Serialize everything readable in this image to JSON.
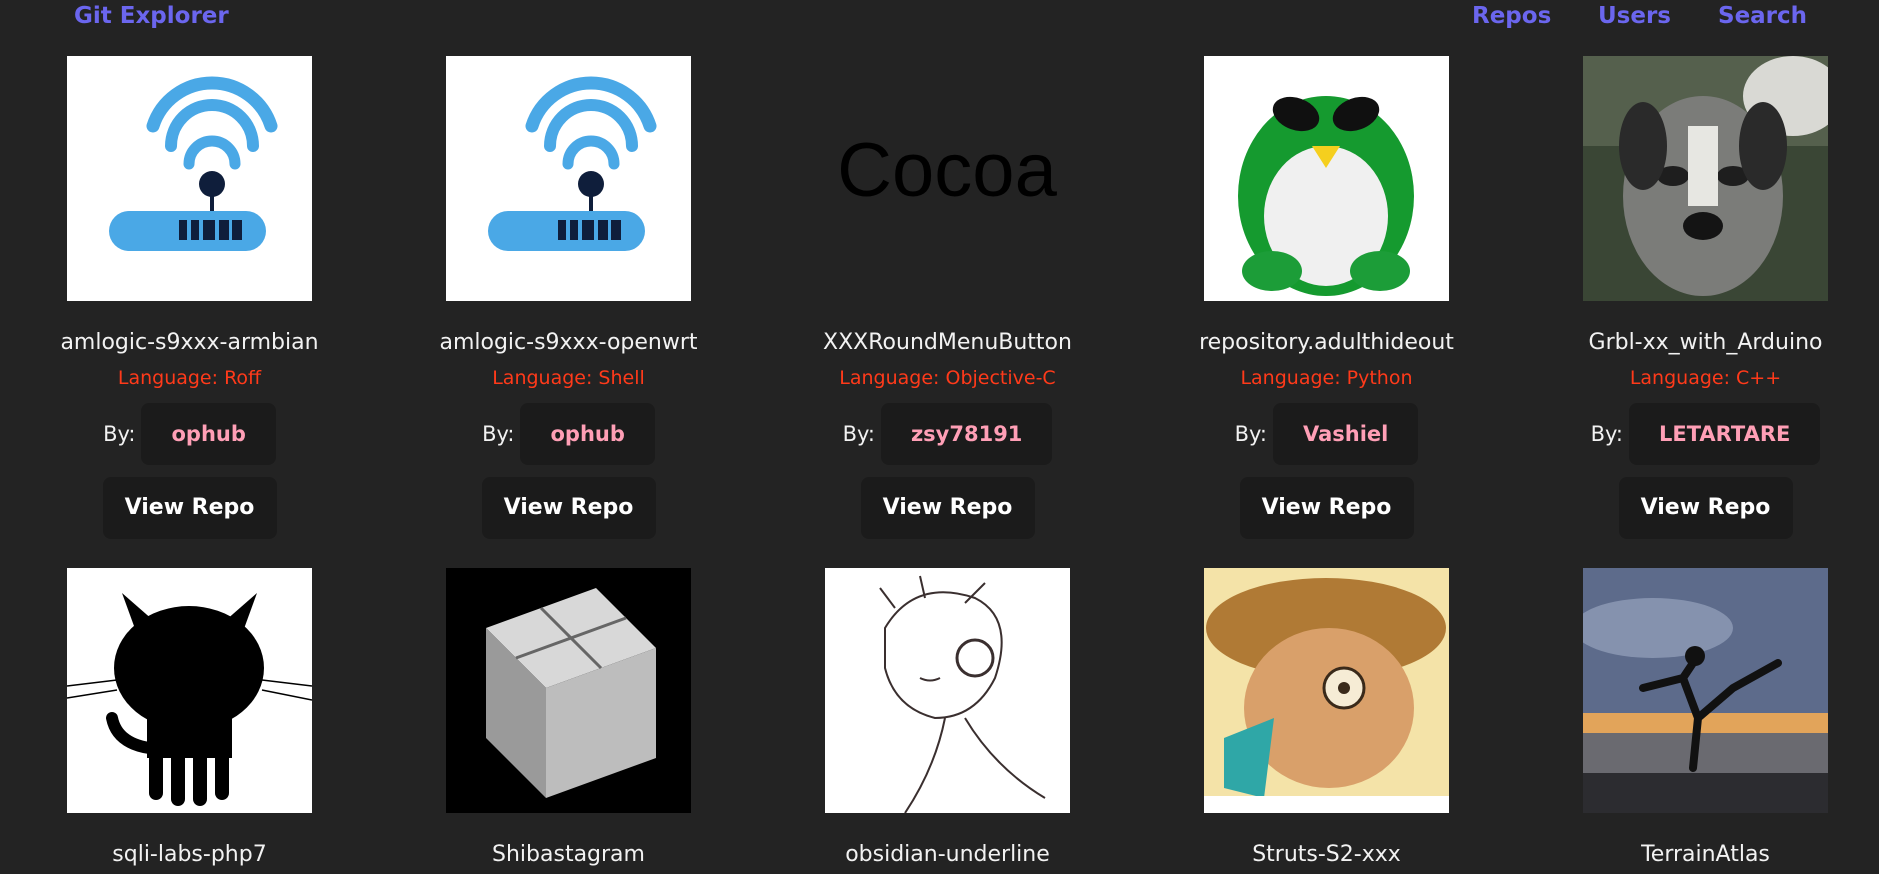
{
  "navbar": {
    "brand": "Git Explorer",
    "links": [
      "Repos",
      "Users",
      "Search"
    ]
  },
  "labels": {
    "by": "By:",
    "view_repo": "View Repo"
  },
  "repos": [
    {
      "name": "amlogic-s9xxx-armbian",
      "language": "Language: Roff",
      "owner": "ophub",
      "avatar": "router-hub-icon"
    },
    {
      "name": "amlogic-s9xxx-openwrt",
      "language": "Language: Shell",
      "owner": "ophub",
      "avatar": "router-hub-icon"
    },
    {
      "name": "XXXRoundMenuButton",
      "language": "Language: Objective-C",
      "owner": "zsy78191",
      "avatar": "cocoa-text-logo",
      "avatar_text": "Cocoa"
    },
    {
      "name": "repository.adulthideout",
      "language": "Language: Python",
      "owner": "Vashiel",
      "avatar": "green-penguin-icon"
    },
    {
      "name": "Grbl-xx_with_Arduino",
      "language": "Language: C++",
      "owner": "LETARTARE",
      "avatar": "dog-photo"
    },
    {
      "name": "sqli-labs-php7",
      "avatar": "octocat-icon"
    },
    {
      "name": "Shibastagram",
      "avatar": "glass-cube-photo"
    },
    {
      "name": "obsidian-underline",
      "avatar": "anime-sketch-drawing"
    },
    {
      "name": "Struts-S2-xxx",
      "avatar": "cartoon-cowboy-drawing"
    },
    {
      "name": "TerrainAtlas",
      "avatar": "sunset-kick-photo"
    }
  ],
  "colors": {
    "background": "#232323",
    "accent": "#6b66ee",
    "language": "#ff3a1a",
    "owner": "#ff9fb6",
    "button_bg": "#1b1b1b"
  }
}
